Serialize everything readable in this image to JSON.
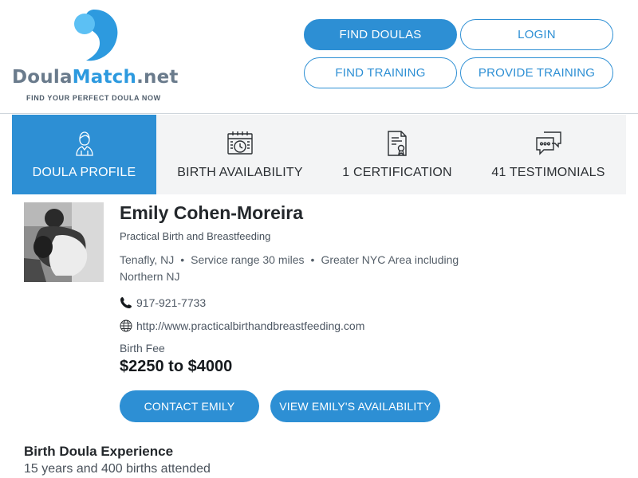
{
  "brand": {
    "name_part1": "Doula",
    "name_part2": "Match",
    "name_part3": ".net",
    "tagline": "FIND YOUR PERFECT DOULA NOW",
    "colors": {
      "accent": "#2d8fd4",
      "logo_blue": "#2d9adf",
      "logo_light": "#5cc0f4",
      "logo_gray": "#6a7b8c"
    }
  },
  "nav": {
    "find_doulas": "FIND DOULAS",
    "login": "LOGIN",
    "find_training": "FIND TRAINING",
    "provide_training": "PROVIDE TRAINING"
  },
  "tabs": [
    {
      "label": "DOULA PROFILE",
      "icon": "doula-person-icon",
      "active": true
    },
    {
      "label": "BIRTH AVAILABILITY",
      "icon": "calendar-clock-icon",
      "active": false
    },
    {
      "label": "1 CERTIFICATION",
      "icon": "certificate-document-icon",
      "active": false
    },
    {
      "label": "41 TESTIMONIALS",
      "icon": "chat-bubbles-icon",
      "active": false
    }
  ],
  "profile": {
    "name": "Emily Cohen-Moreira",
    "business": "Practical Birth and Breastfeeding",
    "location": "Tenafly, NJ",
    "service_range": "Service range 30 miles",
    "area_line1": "Greater NYC Area including",
    "area_line2": "Northern NJ",
    "phone": "917-921-7733",
    "website": "http://www.practicalbirthandbreastfeeding.com",
    "fee_label": "Birth Fee",
    "fee_value": "$2250 to $4000",
    "contact_button": "CONTACT EMILY",
    "availability_button": "VIEW EMILY'S AVAILABILITY"
  },
  "experience": {
    "title": "Birth Doula Experience",
    "text": "15 years and 400 births attended"
  }
}
